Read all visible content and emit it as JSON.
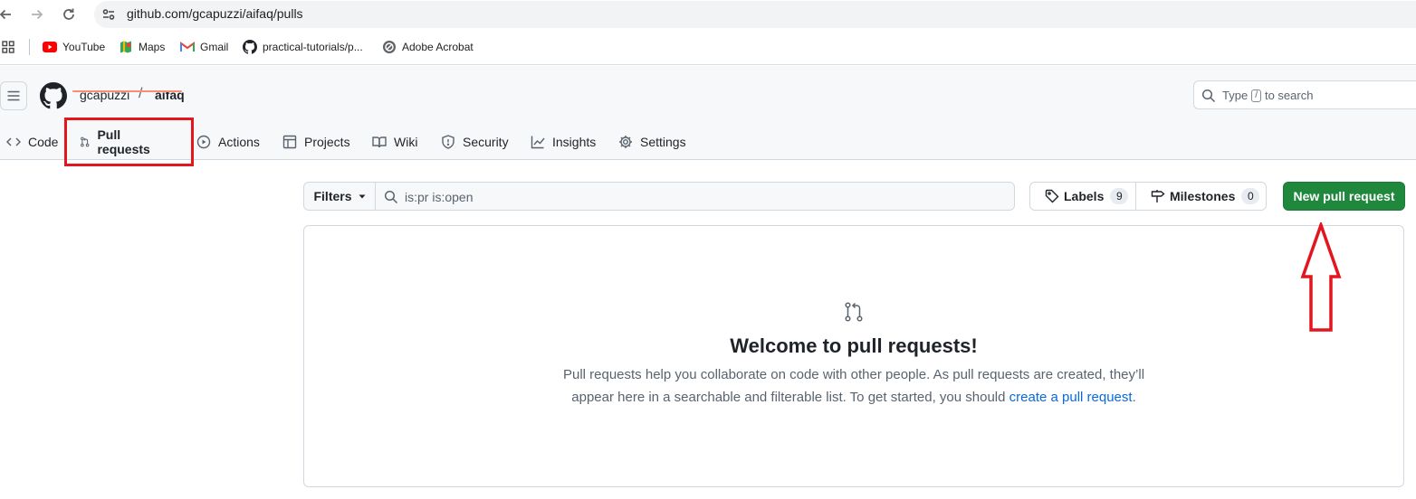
{
  "browser": {
    "url": "github.com/gcapuzzi/aifaq/pulls",
    "bookmarks": [
      {
        "label": "YouTube",
        "icon": "youtube-icon"
      },
      {
        "label": "Maps",
        "icon": "maps-icon"
      },
      {
        "label": "Gmail",
        "icon": "gmail-icon"
      },
      {
        "label": "practical-tutorials/p...",
        "icon": "github-icon"
      },
      {
        "label": "Adobe Acrobat",
        "icon": "acrobat-icon"
      }
    ]
  },
  "header": {
    "owner": "gcapuzzi",
    "separator": "/",
    "repo": "aifaq",
    "search_placeholder_before": "Type",
    "search_key": "/",
    "search_placeholder_after": "to search"
  },
  "tabs": [
    {
      "label": "Code",
      "icon": "code-icon"
    },
    {
      "label": "Pull requests",
      "icon": "git-pull-request-icon",
      "selected": true
    },
    {
      "label": "Actions",
      "icon": "play-icon"
    },
    {
      "label": "Projects",
      "icon": "table-icon"
    },
    {
      "label": "Wiki",
      "icon": "book-icon"
    },
    {
      "label": "Security",
      "icon": "shield-icon"
    },
    {
      "label": "Insights",
      "icon": "graph-icon"
    },
    {
      "label": "Settings",
      "icon": "gear-icon"
    }
  ],
  "toolbar": {
    "filters_label": "Filters",
    "filter_query": "is:pr is:open",
    "labels_label": "Labels",
    "labels_count": "9",
    "milestones_label": "Milestones",
    "milestones_count": "0",
    "new_pr_label": "New pull request"
  },
  "blankslate": {
    "title": "Welcome to pull requests!",
    "desc_line1": "Pull requests help you collaborate on code with other people. As pull requests are created, they’ll",
    "desc_line2_before": "appear here in a searchable and filterable list. To get started, you should",
    "desc_link": "create a pull request",
    "desc_after": "."
  },
  "colors": {
    "accent_green": "#1f883d",
    "link_blue": "#0969da",
    "tab_underline": "#fd8c73",
    "annotation_red": "#e3151d"
  }
}
